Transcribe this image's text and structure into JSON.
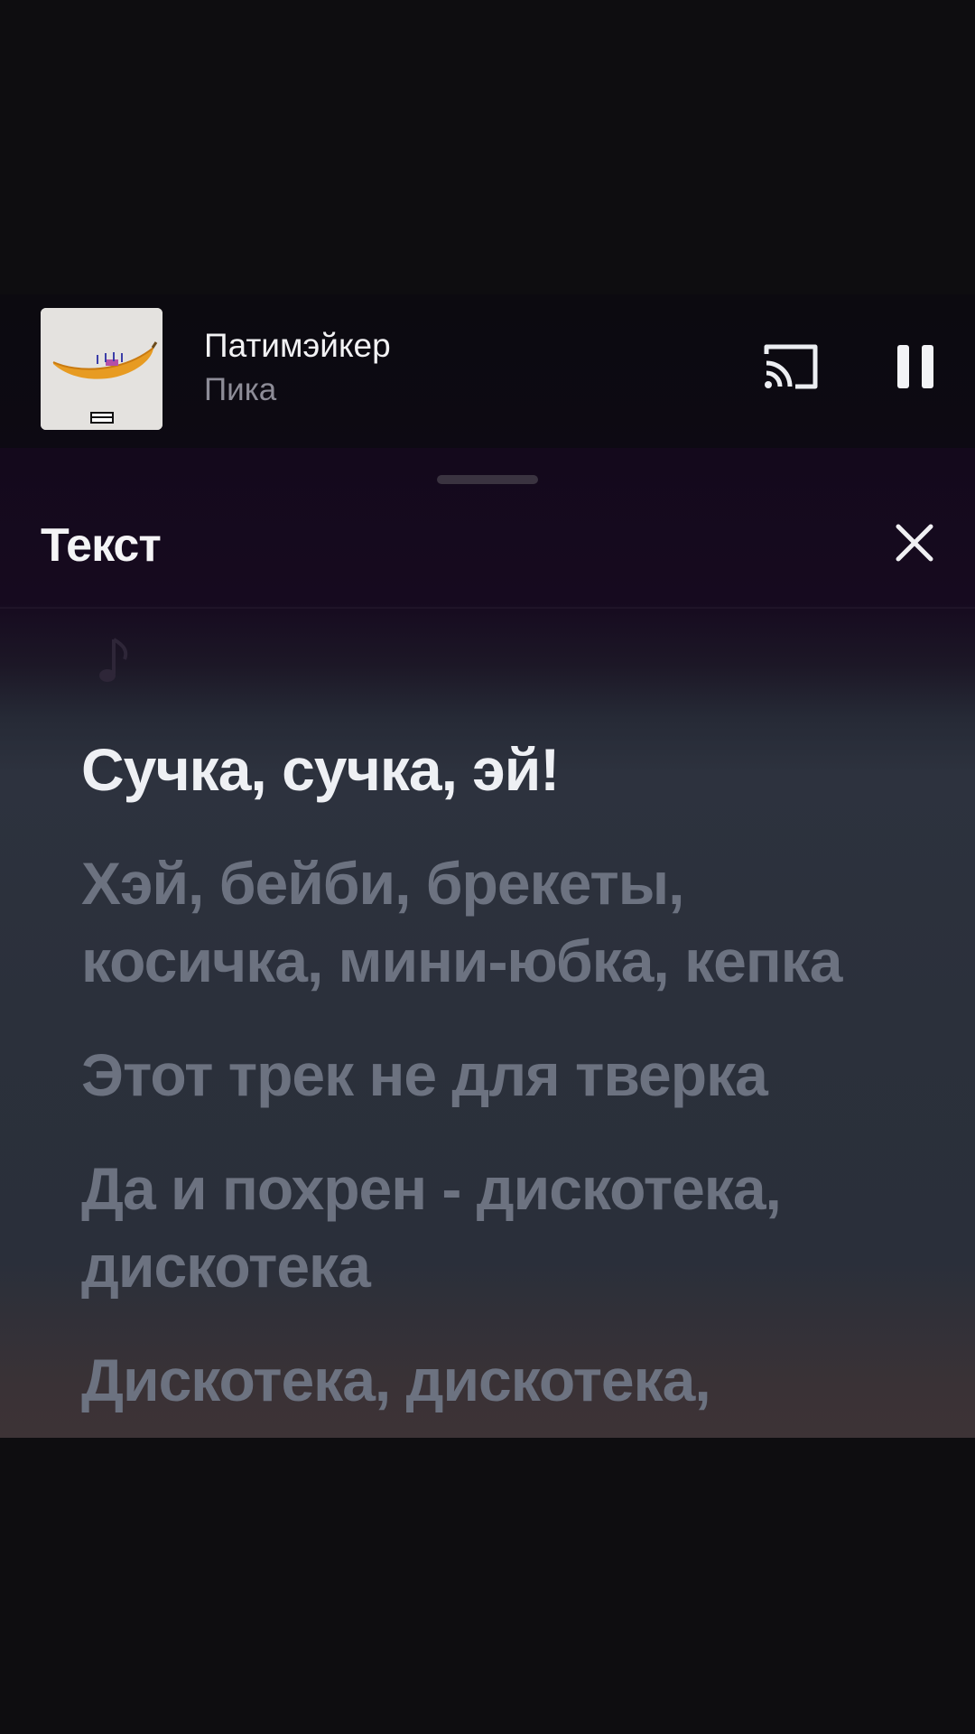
{
  "player": {
    "title": "Патимэйкер",
    "artist": "Пика",
    "cover_icon": "banana-cover-art",
    "cast_icon": "cast-icon",
    "pause_icon": "pause-icon",
    "state": "playing"
  },
  "lyrics_sheet": {
    "title": "Текст",
    "close_icon": "close-icon",
    "note_icon": "music-note-icon",
    "lines": [
      {
        "text": "Сучка, сучка, эй!",
        "active": true
      },
      {
        "text": "Хэй, бейби, брекеты, косичка, мини-юбка, кепка",
        "active": false
      },
      {
        "text": "Этот трек не для тверка",
        "active": false
      },
      {
        "text": "Да и похрен - дискотека, дискотека",
        "active": false
      },
      {
        "text": "Дискотека, дискотека,",
        "active": false
      }
    ]
  },
  "colors": {
    "background": "#0e0d10",
    "sheet_top": "#160a1f",
    "sheet_body": "#2d323e",
    "active_lyric": "#eef0f4",
    "inactive_lyric": "#6c7280"
  }
}
